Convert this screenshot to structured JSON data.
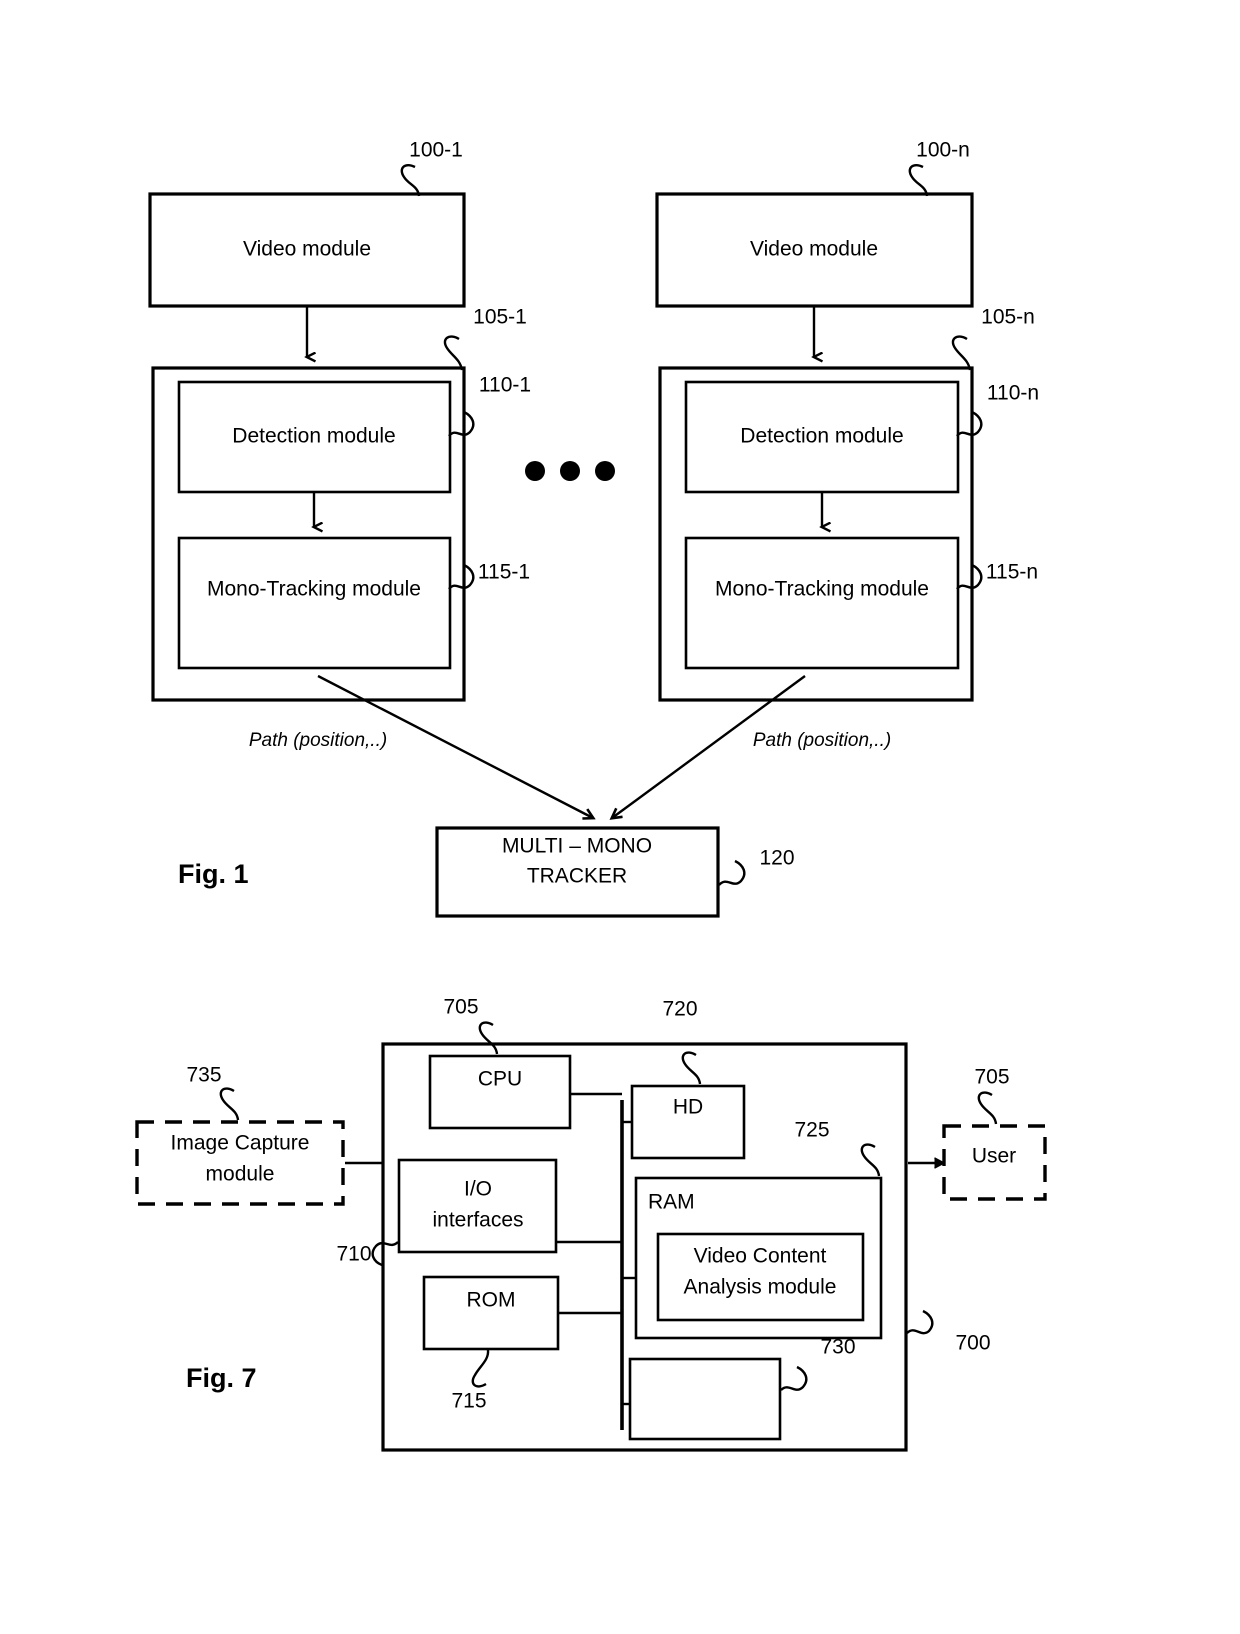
{
  "document": {
    "type": "patent-figure-sheet",
    "figures": [
      "Fig. 1",
      "Fig. 7"
    ]
  },
  "fig1": {
    "label": "Fig. 1",
    "left_chain": {
      "video_module": {
        "text": "Video module",
        "ref": "100-1"
      },
      "container": {
        "ref": "105-1"
      },
      "detection_module": {
        "text": "Detection module",
        "ref": "110-1"
      },
      "mono_tracking_module": {
        "text": "Mono-Tracking module",
        "ref": "115-1"
      },
      "path_label": "Path (position,..)"
    },
    "right_chain": {
      "video_module": {
        "text": "Video module",
        "ref": "100-n"
      },
      "container": {
        "ref": "105-n"
      },
      "detection_module": {
        "text": "Detection module",
        "ref": "110-n"
      },
      "mono_tracking_module": {
        "text": "Mono-Tracking module",
        "ref": "115-n"
      },
      "path_label": "Path (position,..)"
    },
    "ellipsis": "• • •",
    "tracker": {
      "line1": "MULTI – MONO",
      "line2": "TRACKER",
      "ref": "120"
    }
  },
  "fig7": {
    "label": "Fig. 7",
    "image_capture": {
      "text_line1": "Image Capture",
      "text_line2": "module",
      "ref": "735"
    },
    "system": {
      "ref": "700"
    },
    "cpu": {
      "text": "CPU",
      "ref": "705"
    },
    "io": {
      "text_line1": "I/O",
      "text_line2": "interfaces",
      "ref": "710"
    },
    "rom": {
      "text": "ROM",
      "ref": "715"
    },
    "hd": {
      "text": "HD",
      "ref": "720"
    },
    "ram": {
      "text": "RAM",
      "ref": "725"
    },
    "vca": {
      "text_line1": "Video Content",
      "text_line2": "Analysis module"
    },
    "unnamed_block": {
      "text": "",
      "ref": "730"
    },
    "user": {
      "text": "User",
      "ref": "705"
    }
  },
  "colors": {
    "ink": "#000000",
    "paper": "#ffffff"
  }
}
